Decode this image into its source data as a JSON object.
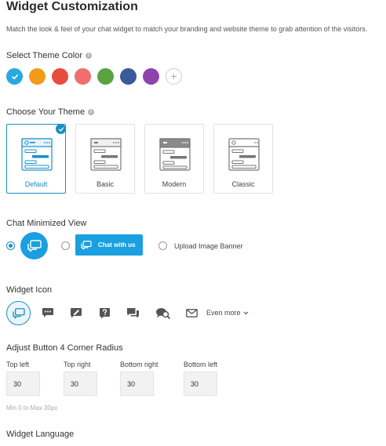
{
  "page": {
    "title": "Widget Customization",
    "subtitle": "Match the look & feel of your chat widget to match your branding and website theme to grab attention of the visitors."
  },
  "theme_color": {
    "label": "Select Theme Color",
    "info_icon": "info-icon",
    "swatches": [
      "#29a8e0",
      "#f29a1a",
      "#ea4c3c",
      "#f06e6e",
      "#5aa23f",
      "#3a5a9a",
      "#8e44ad"
    ],
    "selected_index": 0,
    "add_icon": "plus-icon"
  },
  "theme": {
    "label": "Choose Your Theme",
    "info_icon": "info-icon",
    "options": [
      {
        "label": "Default",
        "selected": true
      },
      {
        "label": "Basic",
        "selected": false
      },
      {
        "label": "Modern",
        "selected": false
      },
      {
        "label": "Classic",
        "selected": false
      }
    ],
    "accent": "#1a8fc7"
  },
  "minimized": {
    "label": "Chat Minimized View",
    "chat_banner_text": "Chat with us",
    "upload_label": "Upload Image Banner",
    "selected": "bubble"
  },
  "widget_icon": {
    "label": "Widget Icon",
    "icons": [
      "chat-bubbles-icon",
      "message-dots-icon",
      "edit-message-icon",
      "question-icon",
      "conversation-icon",
      "search-chat-icon",
      "mail-icon"
    ],
    "selected_index": 0,
    "even_more_label": "Even more"
  },
  "corner_radius": {
    "label": "Adjust Button 4 Corner Radius",
    "fields": [
      {
        "label": "Top left",
        "value": "30"
      },
      {
        "label": "Top right",
        "value": "30"
      },
      {
        "label": "Bottom right",
        "value": "30"
      },
      {
        "label": "Bottom left",
        "value": "30"
      }
    ],
    "hint": "Min 0 to Max 30px"
  },
  "language": {
    "label": "Widget Language"
  }
}
